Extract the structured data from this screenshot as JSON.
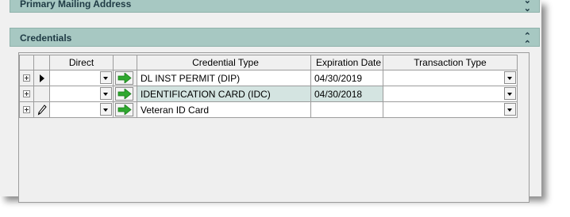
{
  "sections": {
    "mailing": {
      "title": "Primary Mailing Address",
      "chevron_icon": "chevron-double-down-icon"
    },
    "credentials": {
      "title": "Credentials",
      "chevron_icon": "chevron-double-up-icon"
    }
  },
  "grid": {
    "columns": {
      "direct": "Direct",
      "credential_type": "Credential Type",
      "expiration_date": "Expiration Date",
      "transaction_type": "Transaction Type"
    },
    "rows": [
      {
        "indicator": "current-row-arrow-icon",
        "direct": "",
        "credential_type": "DL INST PERMIT (DIP)",
        "expiration_date": "04/30/2019",
        "transaction_type": ""
      },
      {
        "indicator": "",
        "direct": "",
        "credential_type": "IDENTIFICATION CARD (IDC)",
        "expiration_date": "04/30/2018",
        "transaction_type": "",
        "selected": true
      },
      {
        "indicator": "edit-pencil-icon",
        "direct": "",
        "credential_type": "Veteran ID Card",
        "expiration_date": "",
        "transaction_type": ""
      }
    ]
  },
  "colors": {
    "header_bg": "#a7c8c2",
    "selected_row_bg": "#d4e4e1",
    "go_arrow": "#2fa82f"
  }
}
